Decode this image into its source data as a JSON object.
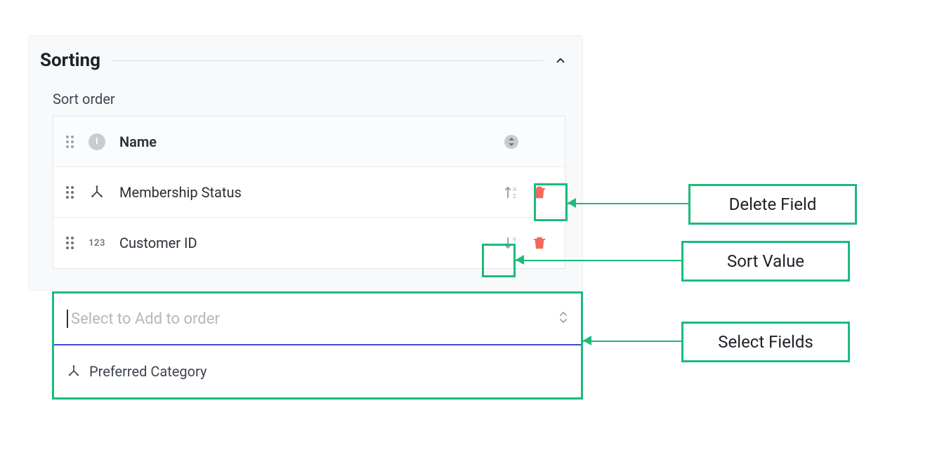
{
  "panel": {
    "title": "Sorting",
    "section_label": "Sort order",
    "header": {
      "name_label": "Name"
    },
    "rows": [
      {
        "name": "Membership Status"
      },
      {
        "name": "Customer ID"
      }
    ],
    "combo": {
      "placeholder": "Select to Add to order",
      "option": "Preferred Category"
    }
  },
  "annotations": {
    "delete_field": "Delete Field",
    "sort_value": "Sort Value",
    "select_fields": "Select Fields"
  },
  "colors": {
    "accent_green": "#1abc7a",
    "accent_blue": "#3b4bdb",
    "trash_red": "#f6685e"
  }
}
